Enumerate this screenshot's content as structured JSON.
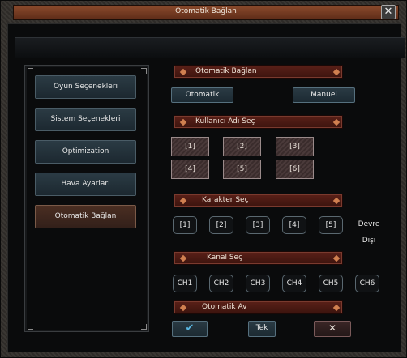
{
  "window": {
    "title": "Otomatik Bağlan"
  },
  "sidebar": {
    "items": [
      {
        "label": "Oyun Seçenekleri"
      },
      {
        "label": "Sistem Seçenekleri"
      },
      {
        "label": "Optimization"
      },
      {
        "label": "Hava Ayarları"
      },
      {
        "label": "Otomatik Bağlan"
      }
    ]
  },
  "sections": {
    "auto_connect": "Otomatik Bağlan",
    "user_select": "Kullanıcı Adı Seç",
    "char_select": "Karakter Seç",
    "channel_select": "Kanal Seç",
    "auto_hunt": "Otomatik Av"
  },
  "mode": {
    "automatic": "Otomatik",
    "manual": "Manuel"
  },
  "users": {
    "slots": [
      "[1]",
      "[2]",
      "[3]",
      "[4]",
      "[5]",
      "[6]"
    ]
  },
  "characters": {
    "slots": [
      "[1]",
      "[2]",
      "[3]",
      "[4]",
      "[5]"
    ],
    "disabled": "Devre Dışı"
  },
  "channels": {
    "slots": [
      "CH1",
      "CH2",
      "CH3",
      "CH4",
      "CH5",
      "CH6"
    ]
  },
  "hunt": {
    "single": "Tek"
  }
}
